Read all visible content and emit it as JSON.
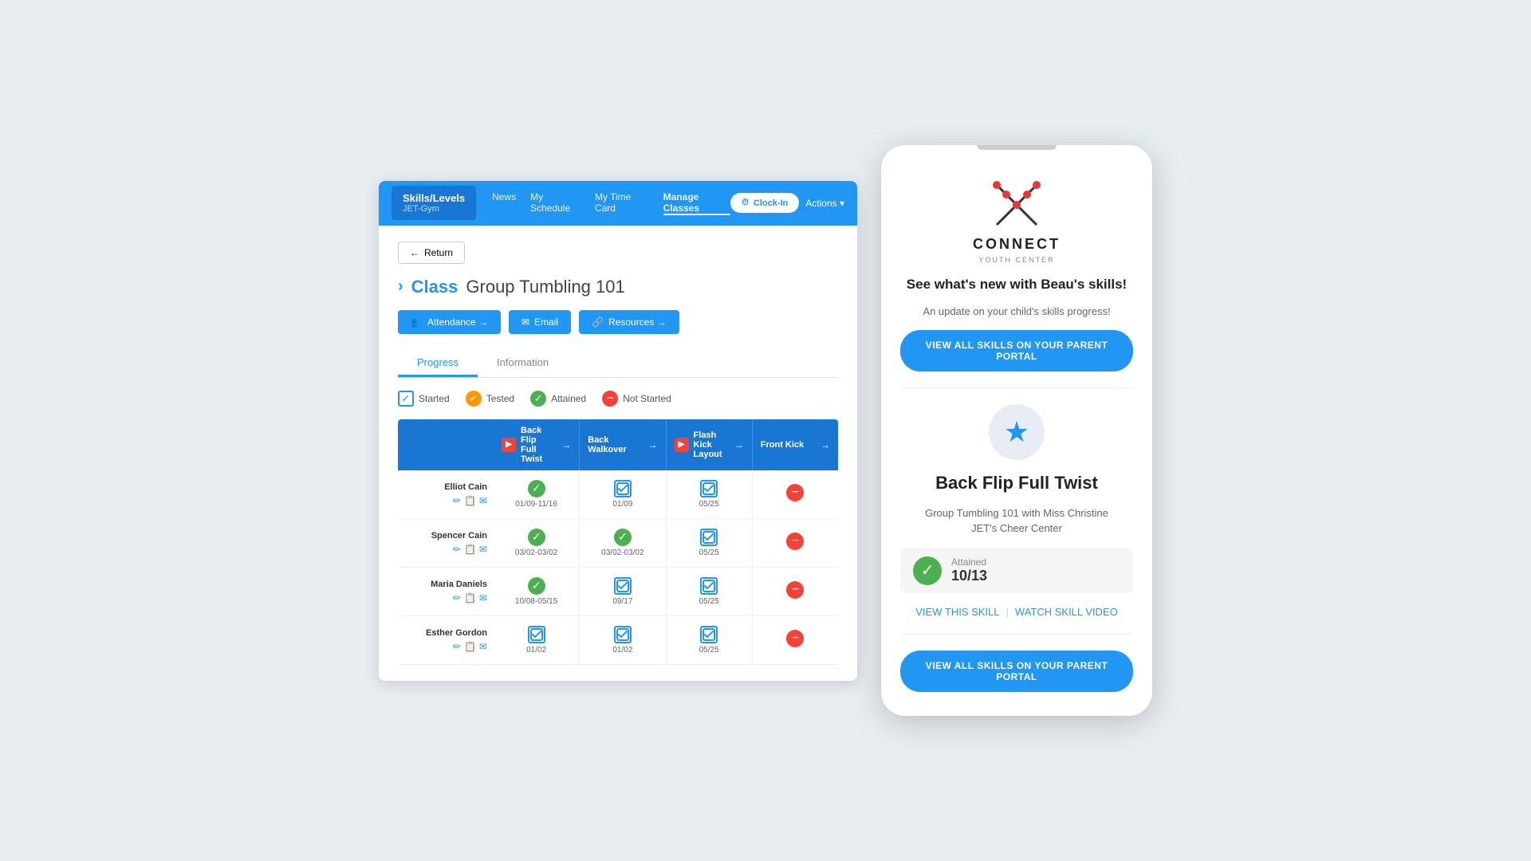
{
  "nav": {
    "brand": "Skills/Levels",
    "gym": "JET-Gym",
    "links": [
      "News",
      "My Schedule",
      "My Time Card",
      "Manage Classes"
    ],
    "active_link": "Manage Classes",
    "clock_in": "Clock-In",
    "actions": "Actions"
  },
  "page": {
    "return_label": "Return",
    "class_label": "Class",
    "class_name": "Group Tumbling 101"
  },
  "action_buttons": {
    "attendance": "Attendance →",
    "email": "Email",
    "resources": "Resources →"
  },
  "tabs": {
    "progress": "Progress",
    "information": "Information"
  },
  "legend": {
    "started": "Started",
    "tested": "Tested",
    "attained": "Attained",
    "not_started": "Not Started"
  },
  "skills": {
    "columns": [
      {
        "name": "Back Flip Full Twist",
        "has_video": true,
        "arrow": "→"
      },
      {
        "name": "Back Walkover",
        "has_video": false,
        "arrow": "→"
      },
      {
        "name": "Flash Kick Layout",
        "has_video": true,
        "arrow": "→"
      },
      {
        "name": "Front Kick",
        "has_video": false,
        "arrow": "→"
      }
    ]
  },
  "students": [
    {
      "name": "Elliot Cain",
      "cells": [
        {
          "status": "attained",
          "date": "01/09-11/16"
        },
        {
          "status": "started",
          "date": "01/09"
        },
        {
          "status": "started",
          "date": "05/25"
        },
        {
          "status": "not_started",
          "date": ""
        }
      ]
    },
    {
      "name": "Spencer Cain",
      "cells": [
        {
          "status": "attained",
          "date": "03/02-03/02"
        },
        {
          "status": "attained",
          "date": "03/02-03/02"
        },
        {
          "status": "started",
          "date": "05/25"
        },
        {
          "status": "not_started",
          "date": ""
        }
      ]
    },
    {
      "name": "Maria Daniels",
      "cells": [
        {
          "status": "attained",
          "date": "10/08-05/15"
        },
        {
          "status": "started",
          "date": "09/17"
        },
        {
          "status": "started",
          "date": "05/25"
        },
        {
          "status": "not_started",
          "date": ""
        }
      ]
    },
    {
      "name": "Esther Gordon",
      "cells": [
        {
          "status": "started",
          "date": "01/02"
        },
        {
          "status": "started",
          "date": "01/02"
        },
        {
          "status": "started",
          "date": "05/25"
        },
        {
          "status": "not_started",
          "date": ""
        }
      ]
    }
  ],
  "mobile": {
    "logo_text": "CONNECT",
    "logo_subtext": "YOUTH CENTER",
    "title": "See what's new with Beau's skills!",
    "subtitle": "An update on your child's skills progress!",
    "view_btn_top": "VIEW ALL SKILLS ON YOUR PARENT PORTAL",
    "skill_name": "Back Flip Full Twist",
    "skill_class": "Group Tumbling 101 with Miss Christine",
    "skill_center": "JET's Cheer Center",
    "attained_label": "Attained",
    "attained_date": "10/13",
    "view_this_skill": "VIEW THIS SKILL",
    "separator": "|",
    "watch_video": "WATCH SKILL VIDEO",
    "view_btn_bottom": "VIEW ALL SKILLS ON YOUR PARENT PORTAL"
  }
}
